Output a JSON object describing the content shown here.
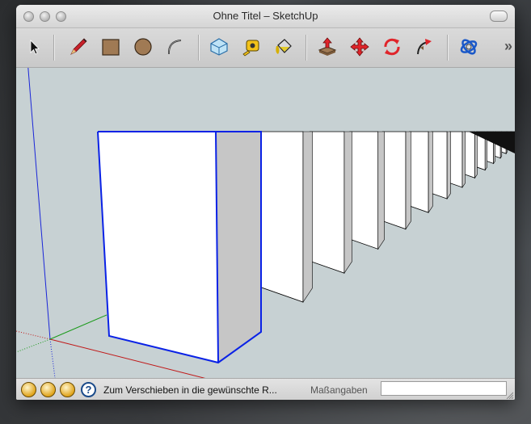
{
  "window": {
    "title": "Ohne Titel – SketchUp"
  },
  "toolbar": {
    "tools": [
      {
        "name": "select-tool",
        "icon": "arrow-cursor-icon"
      },
      {
        "name": "line-tool",
        "icon": "pencil-icon"
      },
      {
        "name": "rectangle-tool",
        "icon": "rectangle-icon"
      },
      {
        "name": "circle-tool",
        "icon": "circle-icon"
      },
      {
        "name": "arc-tool",
        "icon": "arc-icon"
      },
      {
        "name": "make-component-tool",
        "icon": "component-icon"
      },
      {
        "name": "tape-measure-tool",
        "icon": "tape-measure-icon"
      },
      {
        "name": "paint-bucket-tool",
        "icon": "paint-bucket-icon"
      },
      {
        "name": "push-pull-tool",
        "icon": "push-pull-icon"
      },
      {
        "name": "move-tool",
        "icon": "move-icon"
      },
      {
        "name": "rotate-tool",
        "icon": "rotate-icon"
      },
      {
        "name": "follow-me-tool",
        "icon": "follow-me-icon"
      },
      {
        "name": "orbit-tool",
        "icon": "orbit-icon"
      }
    ],
    "overflow_label": "»"
  },
  "statusbar": {
    "text": "Zum Verschieben in die gewünschte R...",
    "measure_label": "Maßangaben",
    "measure_value": "",
    "help_label": "?"
  },
  "colors": {
    "viewport_bg": "#c7d1d3",
    "selection_blue": "#0a22e6",
    "axis_red": "#c01818",
    "axis_green": "#1a9a1a",
    "axis_blue": "#1a26d8"
  }
}
